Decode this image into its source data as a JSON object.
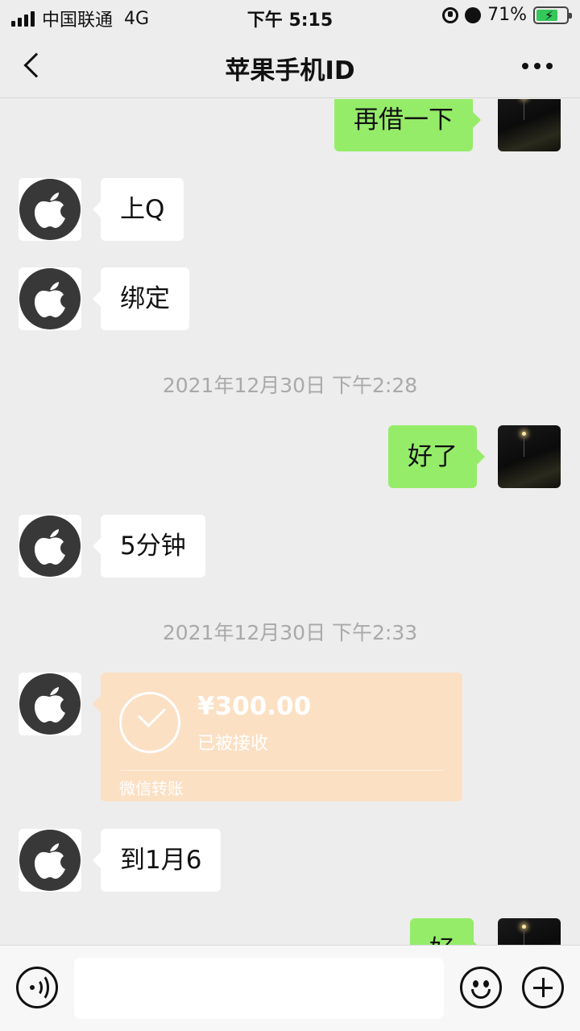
{
  "status_bar": {
    "carrier": "中国联通",
    "network": "4G",
    "time": "下午 5:15",
    "battery": "71%",
    "battery_level": 0.71,
    "icons": [
      "signal-icon",
      "orientation-lock-icon",
      "alarm-icon",
      "battery-charging-icon"
    ]
  },
  "nav": {
    "title": "苹果手机ID",
    "icons": [
      "back-icon",
      "more-icon"
    ]
  },
  "messages": [
    {
      "side": "right",
      "text": "再借一下"
    },
    {
      "side": "left",
      "text": "上Q"
    },
    {
      "side": "left",
      "text": "绑定"
    },
    {
      "type": "timestamp",
      "text": "2021年12月30日 下午2:28"
    },
    {
      "side": "right",
      "text": "好了"
    },
    {
      "side": "left",
      "text": "5分钟"
    },
    {
      "type": "timestamp",
      "text": "2021年12月30日 下午2:33"
    },
    {
      "side": "left",
      "type": "transfer",
      "amount": "¥300.00",
      "status": "已被接收",
      "label": "微信转账"
    },
    {
      "side": "left",
      "text": "到1月6"
    },
    {
      "side": "right",
      "text": "好"
    }
  ],
  "input_bar": {
    "value": "",
    "icons": [
      "voice-icon",
      "emoji-icon",
      "plus-icon"
    ]
  },
  "colors": {
    "background": "#ededed",
    "bubble_self": "#95ec69",
    "bubble_other": "#ffffff",
    "transfer_received": "#fce0c4",
    "timestamp_text": "#a9a9a9"
  }
}
